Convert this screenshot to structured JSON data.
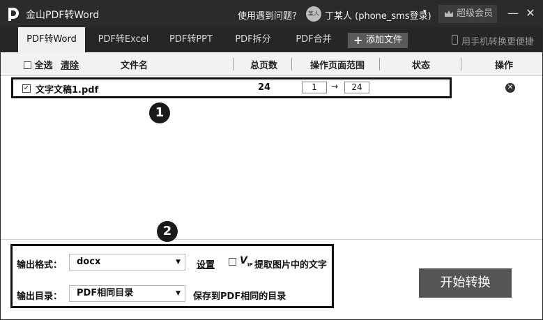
{
  "titlebar": {
    "app_title": "金山PDF转Word",
    "help": "使用遇到问题？",
    "avatar_text": "某人",
    "user": "丁某人 (phone_sms登录)",
    "user_caret": "▾",
    "vip": "超级会员",
    "minimize": "—",
    "close": "✕"
  },
  "tabs": [
    {
      "label": "PDF转Word"
    },
    {
      "label": "PDF转Excel"
    },
    {
      "label": "PDF转PPT"
    },
    {
      "label": "PDF拆分"
    },
    {
      "label": "PDF合并"
    }
  ],
  "add_file": {
    "icon": "+",
    "label": "添加文件"
  },
  "mobile_convert": "用手机转换更便捷",
  "columns": {
    "select_all": "全选",
    "clear": "清除",
    "file_name": "文件名",
    "total_pages": "总页数",
    "page_range": "操作页面范围",
    "status": "状态",
    "action": "操作"
  },
  "file": {
    "checked": "✓",
    "name": "文字文稿1.pdf",
    "pages": "24",
    "range_start": "1",
    "arrow": "→",
    "range_end": "24",
    "remove": "✕"
  },
  "callouts": {
    "one": "1",
    "two": "2"
  },
  "output": {
    "format_label": "输出格式：",
    "format_value": "docx",
    "settings": "设置",
    "vip_mark": "V",
    "vip_sub": "IP",
    "ocr_label": "提取图片中的文字",
    "dir_label": "输出目录：",
    "dir_value": "PDF相同目录",
    "dir_hint": "保存到PDF相同的目录",
    "caret": "▼"
  },
  "start_button": "开始转换"
}
